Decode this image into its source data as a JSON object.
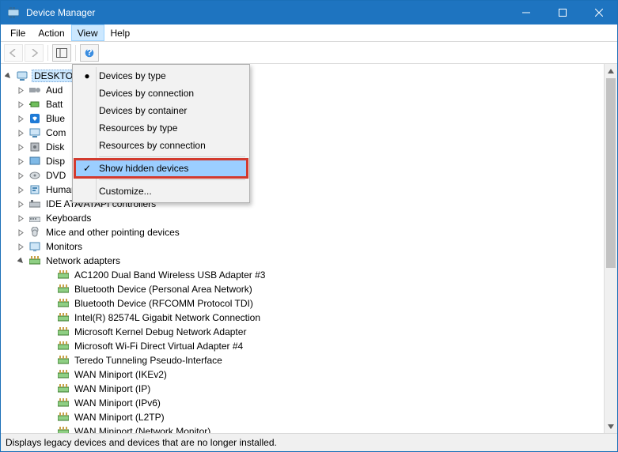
{
  "window": {
    "title": "Device Manager"
  },
  "menubar": {
    "file": "File",
    "action": "Action",
    "view": "View",
    "help": "Help"
  },
  "view_menu": {
    "by_type": "Devices by type",
    "by_conn": "Devices by connection",
    "by_cont": "Devices by container",
    "res_type": "Resources by type",
    "res_conn": "Resources by connection",
    "hidden": "Show hidden devices",
    "customize": "Customize..."
  },
  "tree": {
    "root": "DESKTO",
    "nodes": [
      {
        "label": "Aud",
        "exp": ">"
      },
      {
        "label": "Batt",
        "exp": ">"
      },
      {
        "label": "Blue",
        "exp": ">"
      },
      {
        "label": "Com",
        "exp": ">"
      },
      {
        "label": "Disk",
        "exp": ">"
      },
      {
        "label": "Disp",
        "exp": ">"
      },
      {
        "label": "DVD",
        "exp": ">"
      },
      {
        "label": "Human Interface Devices",
        "exp": ">"
      },
      {
        "label": "IDE ATA/ATAPI controllers",
        "exp": ">"
      },
      {
        "label": "Keyboards",
        "exp": ">"
      },
      {
        "label": "Mice and other pointing devices",
        "exp": ">"
      },
      {
        "label": "Monitors",
        "exp": ">"
      },
      {
        "label": "Network adapters",
        "exp": "v"
      }
    ],
    "net_children": [
      "AC1200  Dual Band Wireless USB Adapter #3",
      "Bluetooth Device (Personal Area Network)",
      "Bluetooth Device (RFCOMM Protocol TDI)",
      "Intel(R) 82574L Gigabit Network Connection",
      "Microsoft Kernel Debug Network Adapter",
      "Microsoft Wi-Fi Direct Virtual Adapter #4",
      "Teredo Tunneling Pseudo-Interface",
      "WAN Miniport (IKEv2)",
      "WAN Miniport (IP)",
      "WAN Miniport (IPv6)",
      "WAN Miniport (L2TP)",
      "WAN Miniport (Network Monitor)"
    ]
  },
  "status": {
    "text": "Displays legacy devices and devices that are no longer installed."
  }
}
